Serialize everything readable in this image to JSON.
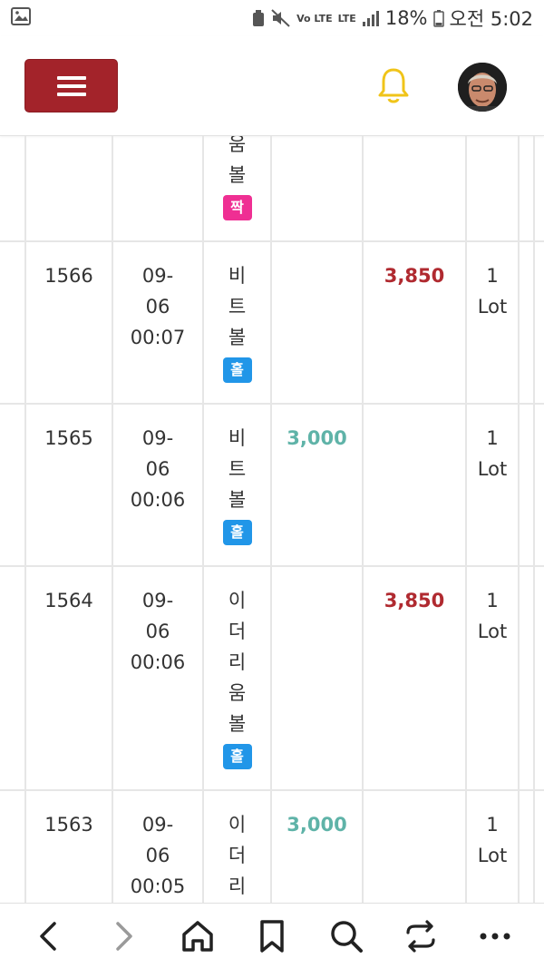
{
  "status_bar": {
    "battery_percent": "18%",
    "time": "오전 5:02",
    "network": "LTE",
    "volte": "Vo LTE",
    "icons": [
      "image-icon",
      "recycle-icon",
      "mute-icon",
      "signal-icon",
      "battery-icon"
    ]
  },
  "header": {
    "menu_icon": "hamburger-icon",
    "bell_icon": "bell-icon",
    "bell_color": "#f0c419",
    "menu_color": "#a3232a"
  },
  "rows": [
    {
      "id": "",
      "time": [
        "",
        "",
        ""
      ],
      "game": [
        "움",
        "볼"
      ],
      "result": "짝",
      "win": "",
      "lose": "",
      "lot": [
        "",
        ""
      ]
    },
    {
      "id": "1566",
      "time": [
        "09-",
        "06",
        "00:07"
      ],
      "game": [
        "비",
        "트",
        "볼"
      ],
      "result": "홀",
      "win": "",
      "lose": "3,850",
      "lot": [
        "1",
        "Lot"
      ]
    },
    {
      "id": "1565",
      "time": [
        "09-",
        "06",
        "00:06"
      ],
      "game": [
        "비",
        "트",
        "볼"
      ],
      "result": "홀",
      "win": "3,000",
      "lose": "",
      "lot": [
        "1",
        "Lot"
      ]
    },
    {
      "id": "1564",
      "time": [
        "09-",
        "06",
        "00:06"
      ],
      "game": [
        "이",
        "더",
        "리",
        "움",
        "볼"
      ],
      "result": "홀",
      "win": "",
      "lose": "3,850",
      "lot": [
        "1",
        "Lot"
      ]
    },
    {
      "id": "1563",
      "time": [
        "09-",
        "06",
        "00:05"
      ],
      "game": [
        "이",
        "더",
        "리"
      ],
      "result": "",
      "win": "3,000",
      "lose": "",
      "lot": [
        "1",
        "Lot"
      ]
    }
  ],
  "colors": {
    "win": "#5fb3a8",
    "lose": "#b02a30",
    "badge_odd": "#2196e8",
    "badge_even": "#ef2f93"
  },
  "bottom_nav": [
    "back-icon",
    "forward-icon",
    "home-icon",
    "bookmark-icon",
    "search-icon",
    "tabs-icon",
    "more-icon"
  ]
}
